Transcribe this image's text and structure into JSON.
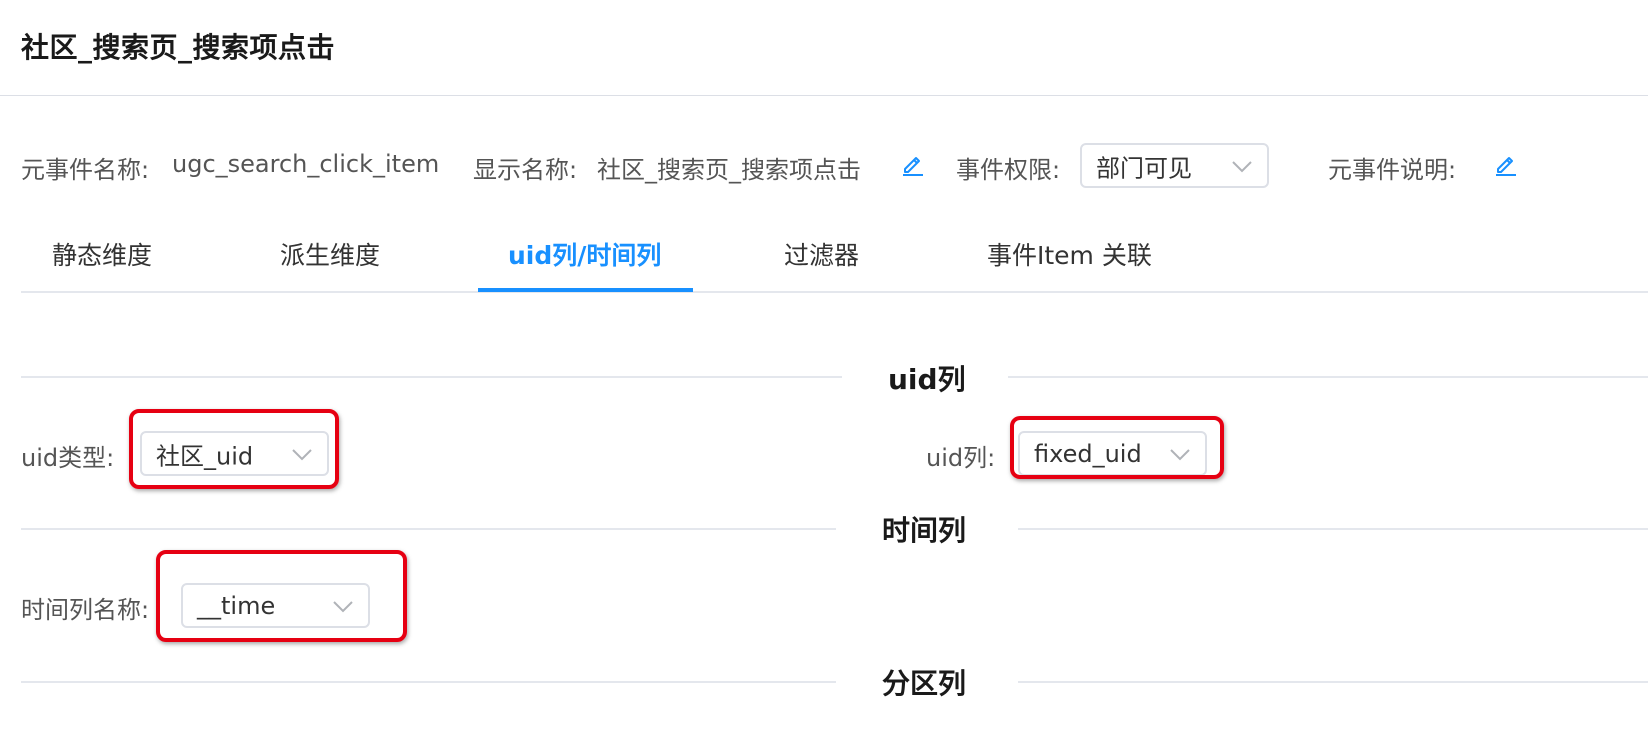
{
  "page": {
    "title": "社区_搜索页_搜索项点击"
  },
  "meta": {
    "event_name_label": "元事件名称:",
    "event_name_value": "ugc_search_click_item",
    "display_name_label": "显示名称:",
    "display_name_value": "社区_搜索页_搜索项点击",
    "permission_label": "事件权限:",
    "permission_value": "部门可见",
    "description_label": "元事件说明:"
  },
  "tabs": [
    {
      "label": "静态维度"
    },
    {
      "label": "派生维度"
    },
    {
      "label": "uid列/时间列"
    },
    {
      "label": "过滤器"
    },
    {
      "label": "事件Item 关联"
    }
  ],
  "active_tab": "uid列/时间列",
  "sections": {
    "uid": {
      "title": "uid列",
      "uid_type_label": "uid类型:",
      "uid_type_value": "社区_uid",
      "uid_col_label": "uid列:",
      "uid_col_value": "fixed_uid"
    },
    "time": {
      "title": "时间列",
      "time_col_label": "时间列名称:",
      "time_col_value": "__time"
    },
    "partition": {
      "title": "分区列"
    }
  },
  "colors": {
    "accent": "#1890ff",
    "highlight": "#e60012"
  },
  "icons": {
    "edit": "edit-pencil-icon",
    "dropdown": "chevron-down-icon"
  }
}
